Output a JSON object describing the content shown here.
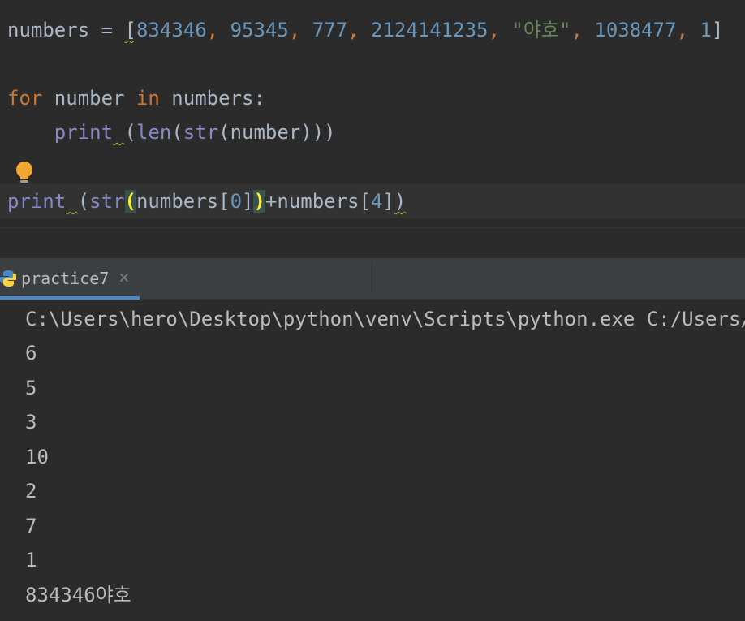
{
  "editor": {
    "line1": {
      "var": "numbers",
      "op": " = ",
      "open": "[",
      "items": [
        "834346",
        "95345",
        "777",
        "2124141235",
        "\"야호\"",
        "1038477",
        "1"
      ],
      "sep": ", ",
      "close": "]"
    },
    "line3": {
      "kw_for": "for",
      "var": " number ",
      "kw_in": "in",
      "rest": " numbers:"
    },
    "line4": {
      "indent": "    ",
      "fn": "print",
      "space": " ",
      "open": "(",
      "fn2": "len",
      "rest": "(",
      "fn3": "str",
      "rest2": "(number)))"
    },
    "line6": {
      "fn": "print",
      "space": " ",
      "open": "(",
      "fn2": "str",
      "paren_open": "(",
      "mid": "numbers[",
      "idx0": "0",
      "mid2": "]",
      "paren_close": ")",
      "plus": "+numbers[",
      "idx4": "4",
      "end": "]",
      "close": ")"
    }
  },
  "run_panel": {
    "tab_label": "practice7",
    "close_glyph": "×"
  },
  "console": {
    "lines": [
      "C:\\Users\\hero\\Desktop\\python\\venv\\Scripts\\python.exe C:/Users/he",
      "6",
      "5",
      "3",
      "10",
      "2",
      "7",
      "1",
      "834346야호"
    ]
  },
  "icons": {
    "bulb": "lightbulb-icon",
    "python": "python-icon",
    "close": "close-icon"
  },
  "colors": {
    "background": "#2b2b2b",
    "keyword": "#cc7832",
    "number": "#6897bb",
    "string": "#6a8759",
    "builtin": "#8888c6",
    "text": "#a9b7c6",
    "tab_accent": "#4a88c7",
    "bulb": "#f0a732"
  }
}
